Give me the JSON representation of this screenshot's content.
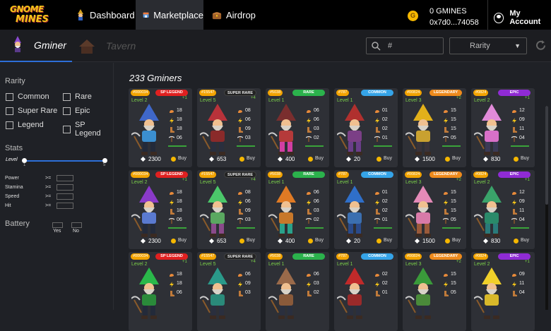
{
  "logo": {
    "line1": "GNOME",
    "line2": "MINES"
  },
  "nav": {
    "dashboard": "Dashboard",
    "marketplace": "Marketplace",
    "airdrop": "Airdrop"
  },
  "wallet": {
    "balance": "0 GMINES",
    "address": "0x7d0...74058",
    "coin_letter": "G"
  },
  "account": {
    "label": "My Account"
  },
  "tabs": {
    "gminer": "Gminer",
    "tavern": "Tavern"
  },
  "search": {
    "value": "#"
  },
  "rarity_select": {
    "value": "Rarity"
  },
  "filters": {
    "rarity_title": "Rarity",
    "rarity": [
      "Common",
      "Rare",
      "Super Rare",
      "Epic",
      "Legend",
      "SP Legend"
    ],
    "stats_title": "Stats",
    "level_label": "Level",
    "level_min": "1",
    "level_max": "5",
    "stat_rows": [
      "Power",
      "Stamina",
      "Speed",
      "Hit"
    ],
    "ge": ">=",
    "battery_title": "Battery",
    "battery_yes": "Yes",
    "battery_no": "No"
  },
  "results": {
    "count": "233 Gminers"
  },
  "colors": {
    "accent": "#2d6fd8",
    "level": "#7bd04a",
    "id_badge": "#f2a300"
  },
  "cards": [
    {
      "id": "#000034",
      "rarity": "SP LEGEND",
      "rcolor": "#e02020",
      "level": "Level 2",
      "plus": "+1",
      "stats": [
        "18",
        "18",
        "18",
        "06"
      ],
      "price": "2300",
      "buy": "Buy",
      "hat": "#3f67c9",
      "shirt": "#3b8fd0",
      "pants": "#232a3a"
    },
    {
      "id": "#15547",
      "rarity": "SUPER RARE",
      "rcolor": "#222",
      "level": "Level 5",
      "plus": "+4",
      "stats": [
        "08",
        "06",
        "09",
        "03"
      ],
      "price": "653",
      "buy": "Buy",
      "hat": "#b8323a",
      "shirt": "#8a2a2a",
      "pants": "#2a2f3e"
    },
    {
      "id": "#5038",
      "rarity": "RARE",
      "rcolor": "#2bb24c",
      "level": "Level 1",
      "plus": "",
      "stats": [
        "06",
        "06",
        "03",
        "02"
      ],
      "price": "400",
      "buy": "Buy",
      "hat": "#7a2e2e",
      "shirt": "#b53a3a",
      "pants": "#d23ea3"
    },
    {
      "id": "#787",
      "rarity": "COMMON",
      "rcolor": "#35a4e8",
      "level": "Level 1",
      "plus": "",
      "stats": [
        "01",
        "02",
        "02",
        "01"
      ],
      "price": "20",
      "buy": "Buy",
      "hat": "#b0302e",
      "shirt": "#7b3f86",
      "pants": "#6a3e8a"
    },
    {
      "id": "#00824",
      "rarity": "LEGENDARY",
      "rcolor": "#ee8a1c",
      "level": "Level 3",
      "plus": "+2",
      "stats": [
        "15",
        "15",
        "15",
        "05"
      ],
      "price": "1500",
      "buy": "Buy",
      "hat": "#e2b01a",
      "shirt": "#c9a130",
      "pants": "#39333a"
    },
    {
      "id": "#0824",
      "rarity": "EPIC",
      "rcolor": "#8f2bd4",
      "level": "Level 2",
      "plus": "+1",
      "stats": [
        "12",
        "09",
        "11",
        "04"
      ],
      "price": "830",
      "buy": "Buy",
      "hat": "#e08ad8",
      "shirt": "#d870c8",
      "pants": "#3a3a55"
    },
    {
      "id": "#000034",
      "rarity": "SP LEGEND",
      "rcolor": "#e02020",
      "level": "Level 2",
      "plus": "+1",
      "stats": [
        "18",
        "18",
        "18",
        "06"
      ],
      "price": "2300",
      "buy": "Buy",
      "hat": "#8a3ac9",
      "shirt": "#5a7ad0",
      "pants": "#232a3a"
    },
    {
      "id": "#15547",
      "rarity": "SUPER RARE",
      "rcolor": "#222",
      "level": "Level 5",
      "plus": "+4",
      "stats": [
        "08",
        "06",
        "09",
        "03"
      ],
      "price": "653",
      "buy": "Buy",
      "hat": "#4bc86a",
      "shirt": "#5aa860",
      "pants": "#8a4a8a"
    },
    {
      "id": "#5038",
      "rarity": "RARE",
      "rcolor": "#2bb24c",
      "level": "Level 1",
      "plus": "",
      "stats": [
        "06",
        "06",
        "03",
        "02"
      ],
      "price": "400",
      "buy": "Buy",
      "hat": "#e07a24",
      "shirt": "#c8782a",
      "pants": "#2aa18a"
    },
    {
      "id": "#787",
      "rarity": "COMMON",
      "rcolor": "#35a4e8",
      "level": "Level 1",
      "plus": "",
      "stats": [
        "01",
        "02",
        "02",
        "01"
      ],
      "price": "20",
      "buy": "Buy",
      "hat": "#2f6fc9",
      "shirt": "#3b6fb0",
      "pants": "#2a4a8a"
    },
    {
      "id": "#00824",
      "rarity": "LEGENDARY",
      "rcolor": "#ee8a1c",
      "level": "Level 3",
      "plus": "+2",
      "stats": [
        "15",
        "15",
        "15",
        "05"
      ],
      "price": "1500",
      "buy": "Buy",
      "hat": "#e48ab8",
      "shirt": "#d87aa8",
      "pants": "#9a5a3a"
    },
    {
      "id": "#0824",
      "rarity": "EPIC",
      "rcolor": "#8f2bd4",
      "level": "Level 2",
      "plus": "+1",
      "stats": [
        "12",
        "09",
        "11",
        "04"
      ],
      "price": "830",
      "buy": "Buy",
      "hat": "#3aa36a",
      "shirt": "#2a8a6a",
      "pants": "#2a7a7a"
    },
    {
      "id": "#000034",
      "rarity": "SP LEGEND",
      "rcolor": "#e02020",
      "level": "Level 2",
      "plus": "+1",
      "stats": [
        "18",
        "18",
        "06",
        ""
      ],
      "price": "",
      "buy": "",
      "hat": "#2ab84a",
      "shirt": "#2a8a3a",
      "pants": "#232a3a"
    },
    {
      "id": "#15547",
      "rarity": "SUPER RARE",
      "rcolor": "#222",
      "level": "Level 5",
      "plus": "+4",
      "stats": [
        "06",
        "09",
        "03",
        ""
      ],
      "price": "",
      "buy": "",
      "hat": "#2a9a8a",
      "shirt": "#2a8a7a",
      "pants": "#2a2f3e"
    },
    {
      "id": "#5038",
      "rarity": "RARE",
      "rcolor": "#2bb24c",
      "level": "Level 1",
      "plus": "",
      "stats": [
        "06",
        "03",
        "02",
        ""
      ],
      "price": "",
      "buy": "",
      "hat": "#9a6a4a",
      "shirt": "#8a5a3a",
      "pants": "#2a2f3e"
    },
    {
      "id": "#787",
      "rarity": "COMMON",
      "rcolor": "#35a4e8",
      "level": "Level 1",
      "plus": "",
      "stats": [
        "02",
        "02",
        "01",
        ""
      ],
      "price": "",
      "buy": "",
      "hat": "#c02a2a",
      "shirt": "#9a2a2a",
      "pants": "#2a2f3e"
    },
    {
      "id": "#00824",
      "rarity": "LEGENDARY",
      "rcolor": "#ee8a1c",
      "level": "Level 3",
      "plus": "+2",
      "stats": [
        "15",
        "15",
        "05",
        ""
      ],
      "price": "",
      "buy": "",
      "hat": "#3a9a3a",
      "shirt": "#4a8a3a",
      "pants": "#2a2f3e"
    },
    {
      "id": "#0824",
      "rarity": "EPIC",
      "rcolor": "#8f2bd4",
      "level": "Level 2",
      "plus": "+1",
      "stats": [
        "09",
        "11",
        "04",
        ""
      ],
      "price": "",
      "buy": "",
      "hat": "#f0d02a",
      "shirt": "#d8b82a",
      "pants": "#2a2f3e"
    }
  ]
}
